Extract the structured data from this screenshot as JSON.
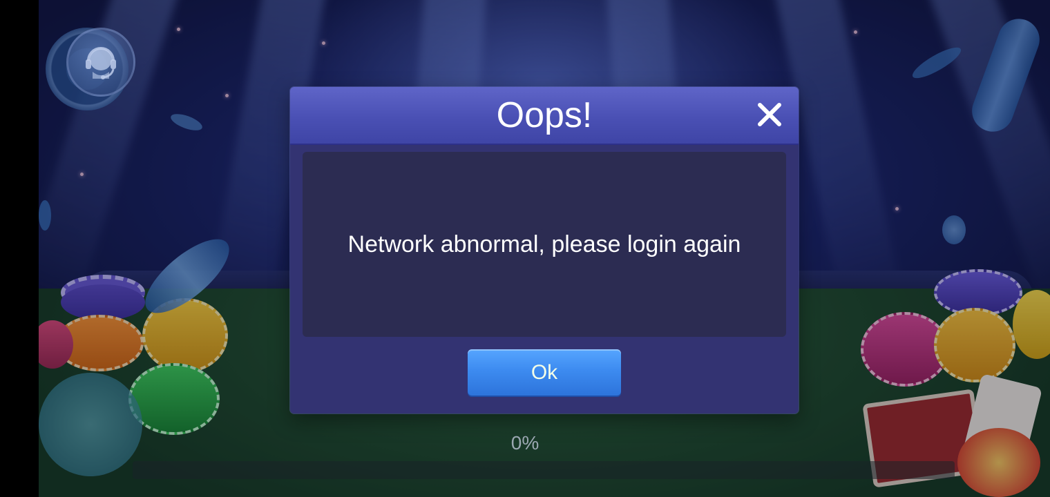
{
  "dialog": {
    "title": "Oops!",
    "message": "Network abnormal, please login again",
    "ok_label": "Ok",
    "close_icon": "close-icon"
  },
  "loading": {
    "progress_text": "0%",
    "progress_value": 0
  },
  "icons": {
    "support": "customer-support-icon"
  },
  "colors": {
    "dialog_bg": "#333372",
    "dialog_header": "#4a50b4",
    "dialog_body": "#2c2c52",
    "ok_button": "#3d8bf0",
    "felt": "#1f4c2b"
  }
}
